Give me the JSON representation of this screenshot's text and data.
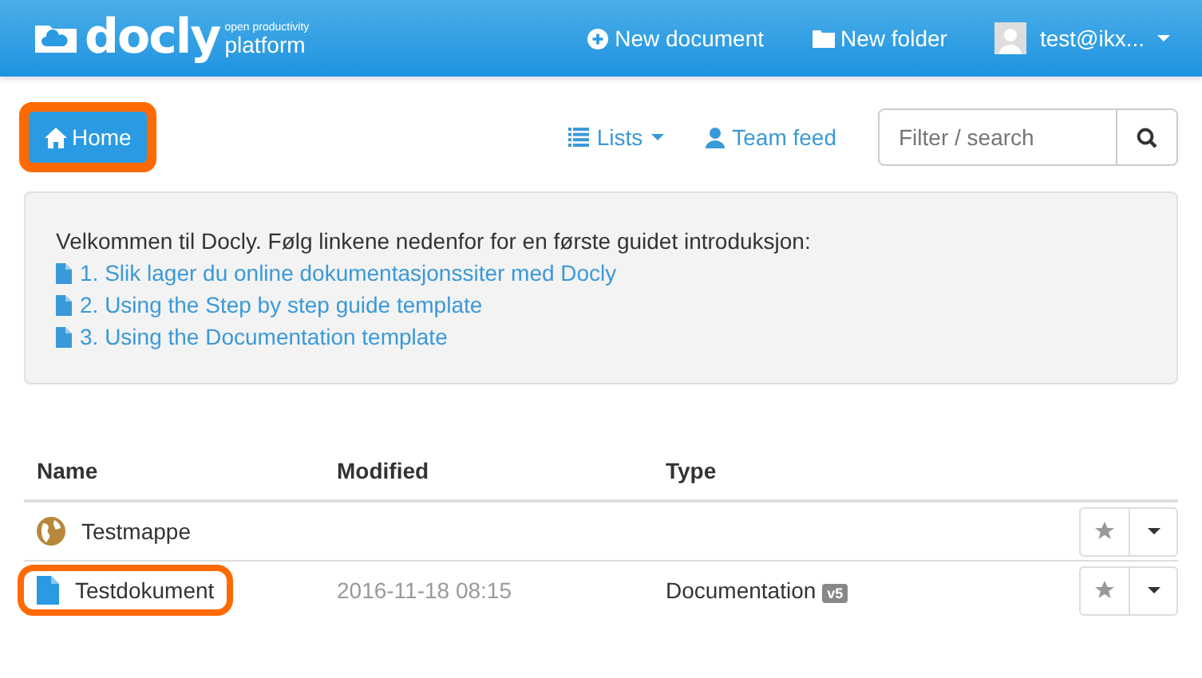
{
  "navbar": {
    "logo": "docly",
    "tagline_top": "open productivity",
    "tagline_bottom": "platform",
    "actions": [
      {
        "kind": "document",
        "label": "New document"
      },
      {
        "kind": "folder",
        "label": "New folder"
      }
    ],
    "user": "test@ikx..."
  },
  "toolbar": {
    "home": {
      "label": "Home",
      "highlighted": true
    },
    "lists": "Lists",
    "team_feed": "Team feed",
    "search": {
      "placeholder": "Filter / search"
    }
  },
  "welcome": {
    "intro": "Velkommen til Docly. Følg linkene nedenfor for en første guidet introduksjon:",
    "links": [
      "1. Slik lager du online dokumentasjonssiter med Docly",
      "2. Using the Step by step guide template",
      "3. Using the Documentation template"
    ]
  },
  "table": {
    "columns": [
      "Name",
      "Modified",
      "Type"
    ],
    "rows": [
      {
        "kind": "folder",
        "name": "Testmappe",
        "highlighted": false
      },
      {
        "kind": "document",
        "name": "Testdokument",
        "modified": "2016-11-18 08:15",
        "type": "Documentation",
        "version": "v5",
        "highlighted": true
      }
    ]
  }
}
